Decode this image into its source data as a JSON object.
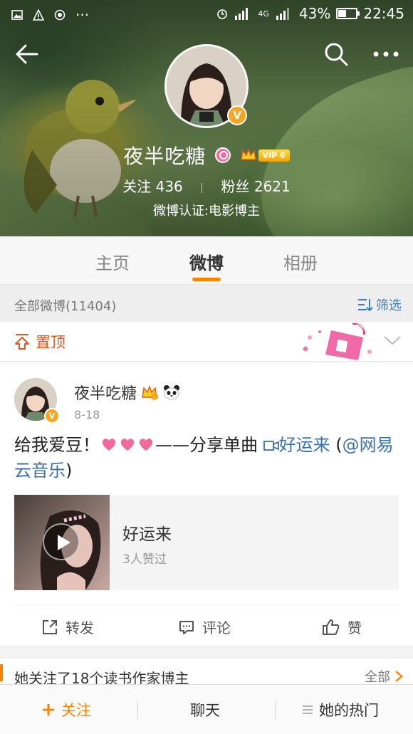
{
  "status_bar": {
    "network": "4G",
    "battery": "43%",
    "time": "22:45"
  },
  "profile": {
    "name": "夜半吃糖",
    "vip_level": "VIP 6",
    "following_label": "关注",
    "following_count": "436",
    "followers_label": "粉丝",
    "followers_count": "2621",
    "certification": "微博认证:电影博主",
    "verified_badge": "V"
  },
  "tabs": [
    {
      "label": "主页"
    },
    {
      "label": "微博"
    },
    {
      "label": "相册"
    }
  ],
  "filter_row": {
    "count_text": "全部微博(11404)",
    "filter_label": "筛选"
  },
  "pinned": {
    "label": "置顶"
  },
  "post": {
    "author": "夜半吃糖",
    "date": "8-18",
    "text_before": "给我爱豆！",
    "text_middle": "——分享单曲 ",
    "song_link": "好运来",
    "text_open_paren": " (",
    "mention_link": "@网易云音乐",
    "text_close_paren": ")",
    "music_card": {
      "title": "好运来",
      "likes_text": "3人赞过"
    },
    "actions": {
      "repost": "转发",
      "comment": "评论",
      "like": "赞"
    }
  },
  "recommend": {
    "title": "她关注了18个读书作家博主",
    "all_label": "全部"
  },
  "bottom_bar": {
    "follow": "关注",
    "chat": "聊天",
    "hot": "她的热门"
  },
  "colors": {
    "accent_orange": "#ff8200",
    "link_blue": "#3a6fb0",
    "verified_gold": "#f5a623",
    "pin_red": "#e8541e"
  },
  "icons": [
    "back-arrow-icon",
    "search-icon",
    "more-icon",
    "gender-female-icon",
    "crown-icon",
    "filter-icon",
    "pin-icon",
    "chevron-down-icon",
    "play-icon",
    "repost-icon",
    "comment-icon",
    "like-icon",
    "chevron-right-icon",
    "plus-icon",
    "menu-icon"
  ]
}
